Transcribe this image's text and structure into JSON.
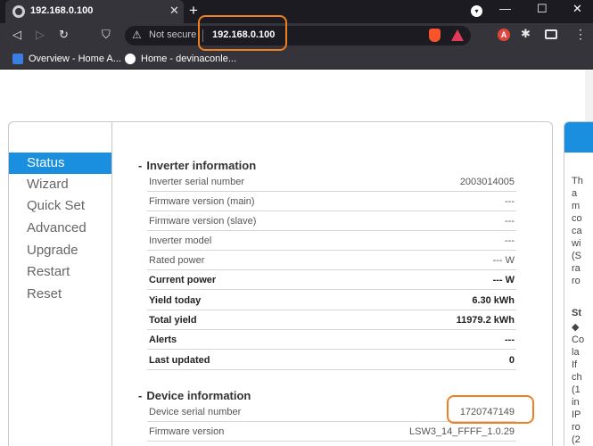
{
  "browser": {
    "tab_title": "192.168.0.100",
    "tab_close": "✕",
    "new_tab": "+",
    "profile_icon": "▾",
    "window_controls": {
      "minimize": "—",
      "maximize": "☐",
      "close": "✕"
    },
    "nav": {
      "back": "◁",
      "forward": "▷",
      "reload": "↻",
      "bookmark": "⛉"
    },
    "security_icon": "⚠",
    "security_label": "Not secure",
    "url": "192.168.0.100",
    "ext_a_label": "A",
    "puzzle_icon": "✱",
    "menu_icon": "⋮",
    "bookmarks": [
      {
        "label": "Overview - Home A..."
      },
      {
        "label": "Home - devinaconle..."
      }
    ]
  },
  "sidebar": {
    "items": [
      {
        "label": "Status",
        "active": true
      },
      {
        "label": "Wizard"
      },
      {
        "label": "Quick Set"
      },
      {
        "label": "Advanced"
      },
      {
        "label": "Upgrade"
      },
      {
        "label": "Restart"
      },
      {
        "label": "Reset"
      }
    ]
  },
  "inverter": {
    "dash": "-",
    "title": "Inverter information",
    "rows": [
      {
        "label": "Inverter serial number",
        "value": "2003014005"
      },
      {
        "label": "Firmware version (main)",
        "value": "---"
      },
      {
        "label": "Firmware version (slave)",
        "value": "---"
      },
      {
        "label": "Inverter model",
        "value": "---"
      },
      {
        "label": "Rated power",
        "value": "--- W"
      },
      {
        "label": "Current power",
        "value": "--- W"
      },
      {
        "label": "Yield today",
        "value": "6.30 kWh"
      },
      {
        "label": "Total yield",
        "value": "11979.2 kWh"
      },
      {
        "label": "Alerts",
        "value": "---"
      },
      {
        "label": "Last updated",
        "value": "0"
      }
    ]
  },
  "device": {
    "dash": "-",
    "title": "Device information",
    "rows": [
      {
        "label": "Device serial number",
        "value": "1720747149"
      },
      {
        "label": "Firmware version",
        "value": "LSW3_14_FFFF_1.0.29"
      }
    ]
  },
  "right_panel": {
    "lines": [
      "Th",
      "a",
      "m",
      "co",
      "ca",
      "wi",
      "(S",
      "ra",
      "ro",
      "",
      "St",
      "◆",
      "Co",
      "la",
      "If",
      "ch",
      "(1",
      "in",
      "IP",
      "ro",
      "(2"
    ]
  },
  "colors": {
    "accent": "#1a8fe0",
    "highlight": "#f07f24"
  }
}
